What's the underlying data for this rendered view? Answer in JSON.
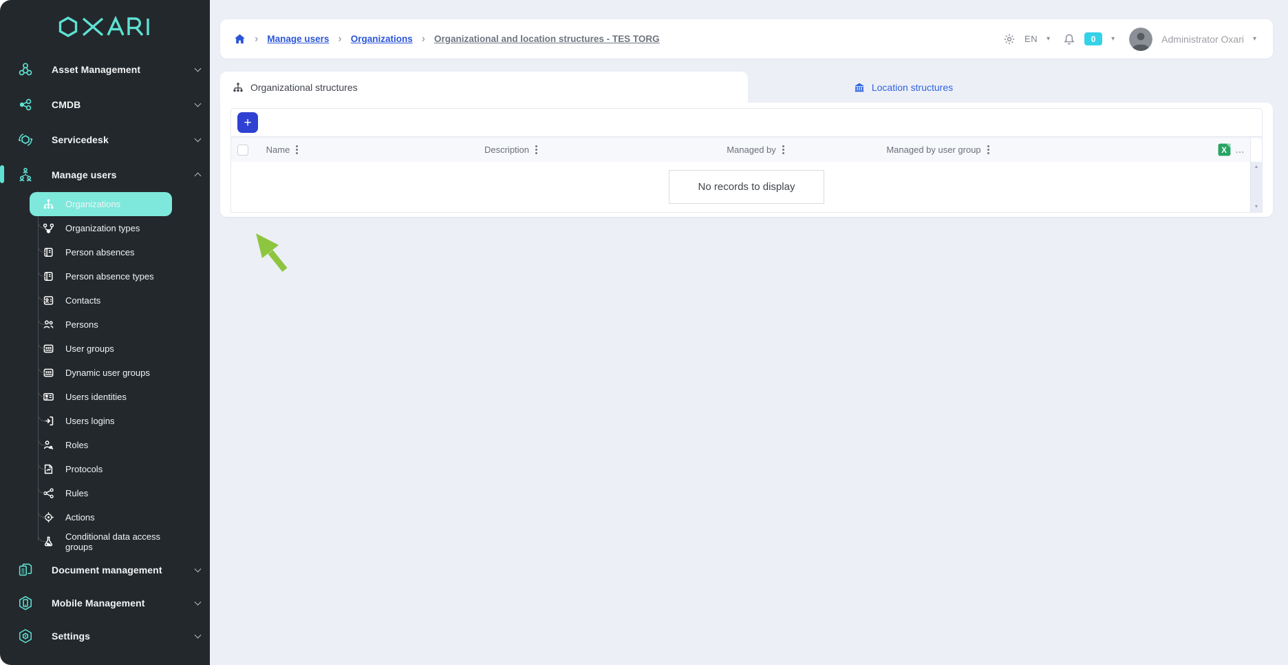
{
  "app": {
    "logo_text": "OXARI"
  },
  "sidebar": {
    "items": [
      {
        "label": "Asset Management",
        "icon": "asset-management-icon"
      },
      {
        "label": "CMDB",
        "icon": "cmdb-icon"
      },
      {
        "label": "Servicedesk",
        "icon": "servicedesk-icon"
      },
      {
        "label": "Manage users",
        "icon": "manage-users-icon",
        "expanded": true
      },
      {
        "label": "Document management",
        "icon": "document-management-icon"
      },
      {
        "label": "Mobile Management",
        "icon": "mobile-management-icon"
      },
      {
        "label": "Settings",
        "icon": "settings-icon"
      }
    ],
    "manage_users_children": [
      {
        "label": "Organizations",
        "icon": "sitemap-icon",
        "selected": true
      },
      {
        "label": "Organization types",
        "icon": "nodes-icon"
      },
      {
        "label": "Person absences",
        "icon": "book-icon"
      },
      {
        "label": "Person absence types",
        "icon": "book-icon"
      },
      {
        "label": "Contacts",
        "icon": "contact-card-icon"
      },
      {
        "label": "Persons",
        "icon": "people-icon"
      },
      {
        "label": "User groups",
        "icon": "user-group-icon"
      },
      {
        "label": "Dynamic user groups",
        "icon": "user-group-icon"
      },
      {
        "label": "Users identities",
        "icon": "id-card-icon"
      },
      {
        "label": "Users logins",
        "icon": "login-icon"
      },
      {
        "label": "Roles",
        "icon": "role-icon"
      },
      {
        "label": "Protocols",
        "icon": "protocol-icon"
      },
      {
        "label": "Rules",
        "icon": "rules-icon"
      },
      {
        "label": "Actions",
        "icon": "target-icon"
      },
      {
        "label": "Conditional data access groups",
        "icon": "flask-icon"
      }
    ]
  },
  "breadcrumb": {
    "separator": "›",
    "items": [
      {
        "label": "Manage users"
      },
      {
        "label": "Organizations"
      },
      {
        "label": "Organizational and location structures - TES TORG",
        "current": true
      }
    ]
  },
  "topbar": {
    "language": "EN",
    "notification_count": "0",
    "user_name": "Administrator Oxari",
    "caret_glyph": "▾"
  },
  "tabs": [
    {
      "label": "Organizational structures",
      "active": true,
      "icon": "sitemap-icon"
    },
    {
      "label": "Location structures",
      "active": false,
      "icon": "building-icon"
    }
  ],
  "grid": {
    "add_button_label": "+",
    "columns": [
      {
        "label": "Name"
      },
      {
        "label": "Description"
      },
      {
        "label": "Managed by"
      },
      {
        "label": "Managed by user group"
      }
    ],
    "export_icon": "excel-export-icon",
    "more_label": "...",
    "empty_message": "No records to display",
    "scroll_up_glyph": "▲",
    "scroll_down_glyph": "▼"
  },
  "colors": {
    "sidebar_bg": "#23282c",
    "accent_teal": "#5ee1d3",
    "selected_pill": "#7de8db",
    "page_bg": "#edeff7",
    "link_blue": "#2b55d9",
    "primary_button_blue": "#2e41d3",
    "tab_blue": "#2d64e0",
    "badge_cyan": "#35d2e7",
    "annotation_green": "#8dc53f",
    "excel_green": "#27a463"
  }
}
